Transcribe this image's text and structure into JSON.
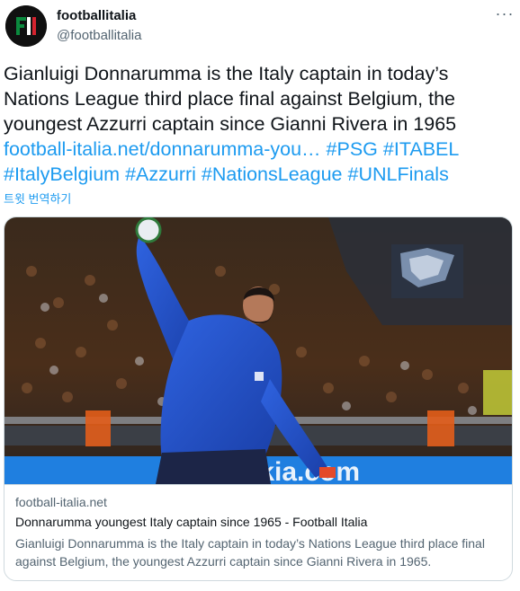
{
  "account": {
    "name": "footballitalia",
    "handle": "@footballitalia",
    "avatar_letters": "FI",
    "avatar_colors": [
      "#0b8a3e",
      "#ffffff",
      "#d5232f"
    ]
  },
  "tweet": {
    "text_before_link": "Gianluigi Donnarumma is the Italy captain in today’s Nations League third place final against Belgium, the youngest Azzurri captain since Gianni Rivera in 1965",
    "link_text": "football-italia.net/donnarumma-you…",
    "hashtags": [
      "#PSG",
      "#ITABEL",
      "#ItalyBelgium",
      "#Azzurri",
      "#NationsLeague",
      "#UNLFinals"
    ],
    "translate_label": "트윗 번역하기"
  },
  "card": {
    "domain": "football-italia.net",
    "title": "Donnarumma youngest Italy captain since 1965 - Football Italia",
    "description": "Gianluigi Donnarumma is the Italy captain in today’s Nations League third place final against Belgium, the youngest Azzurri captain since Gianni Rivera in 1965.",
    "image_subject": "goalkeeper-throwing-ball-photo",
    "banner_text": "okia.com"
  },
  "menu": {
    "more_label": "···"
  },
  "colors": {
    "link": "#1d9bf0",
    "muted": "#536471",
    "text": "#0f1419",
    "kit_blue": "#1f4fcf"
  }
}
